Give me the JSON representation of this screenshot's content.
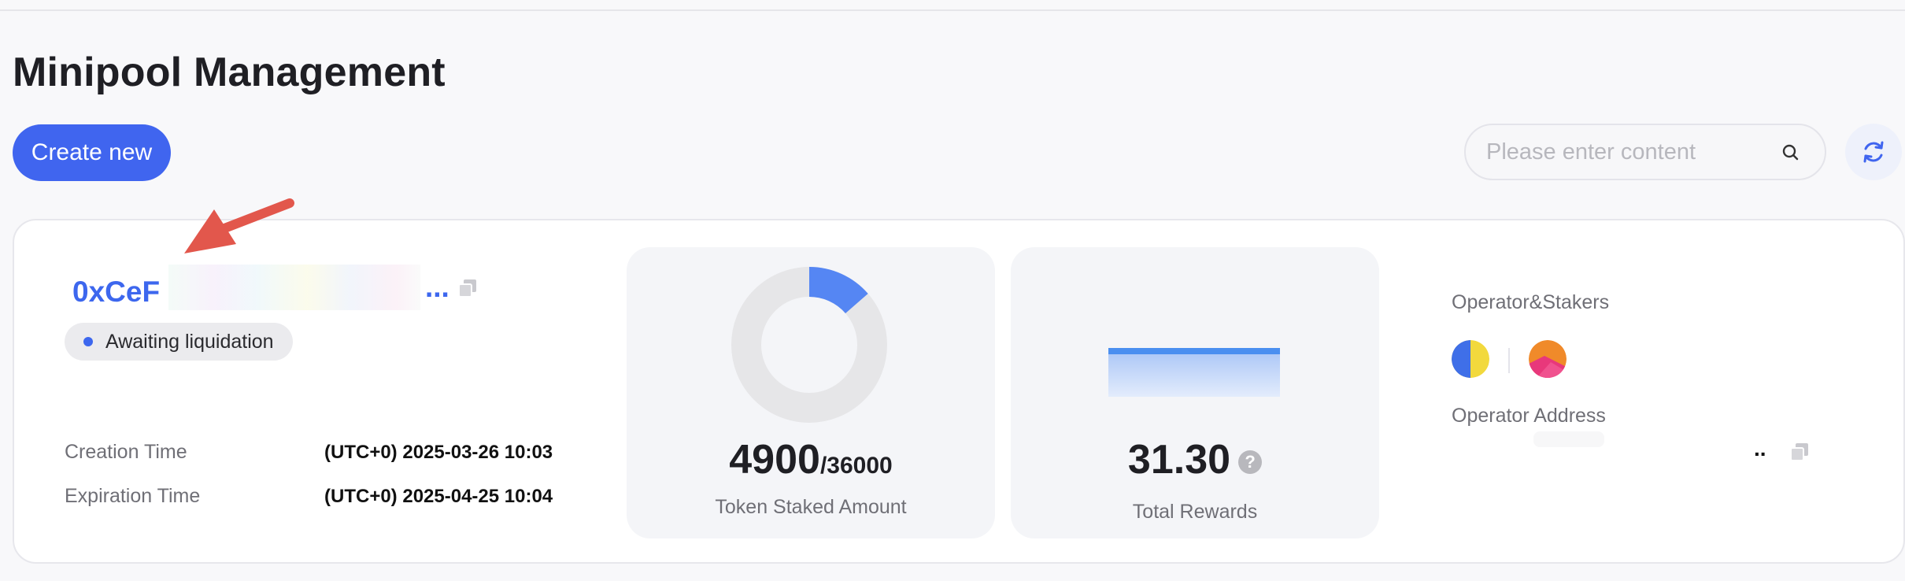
{
  "page": {
    "title": "Minipool Management"
  },
  "toolbar": {
    "create_label": "Create new",
    "search_placeholder": "Please enter content",
    "search_value": ""
  },
  "minipool": {
    "address_prefix": "0xCeF",
    "address_suffix": "...",
    "status": "Awaiting liquidation",
    "creation_label": "Creation Time",
    "creation_value": "(UTC+0) 2025-03-26 10:03",
    "expiration_label": "Expiration Time",
    "expiration_value": "(UTC+0) 2025-04-25 10:04"
  },
  "staked": {
    "amount": "4900",
    "total": "/36000",
    "label": "Token Staked Amount",
    "fraction": 0.136
  },
  "rewards": {
    "value": "31.30",
    "help": "?",
    "label": "Total Rewards"
  },
  "operator": {
    "stakers_label": "Operator&Stakers",
    "address_label": "Operator Address",
    "address_suffix": ".."
  },
  "colors": {
    "accent": "#4065ef",
    "link": "#3d67ee",
    "annotation_arrow": "#e2574c"
  }
}
